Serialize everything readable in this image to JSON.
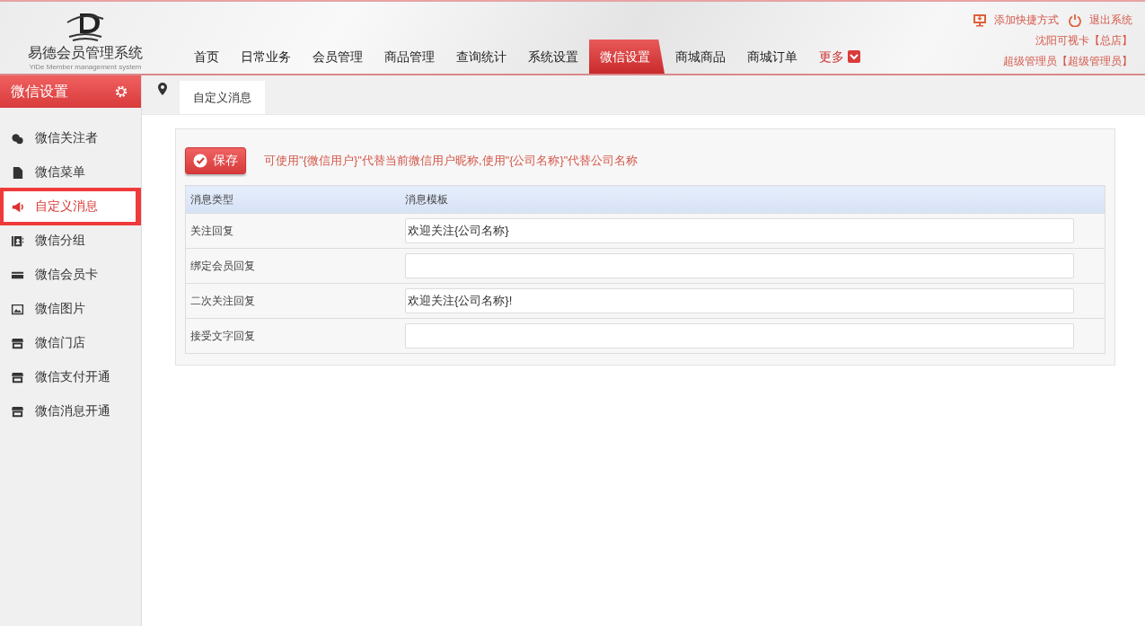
{
  "logo": {
    "title": "易德会员管理系统",
    "subtitle": "YiDe Member management system"
  },
  "nav": [
    {
      "label": "首页",
      "selected": false,
      "kind": "link"
    },
    {
      "label": "日常业务",
      "selected": false,
      "kind": "link"
    },
    {
      "label": "会员管理",
      "selected": false,
      "kind": "link"
    },
    {
      "label": "商品管理",
      "selected": false,
      "kind": "link"
    },
    {
      "label": "查询统计",
      "selected": false,
      "kind": "link"
    },
    {
      "label": "系统设置",
      "selected": false,
      "kind": "link"
    },
    {
      "label": "微信设置",
      "selected": true,
      "kind": "link"
    },
    {
      "label": "商城商品",
      "selected": false,
      "kind": "link"
    },
    {
      "label": "商城订单",
      "selected": false,
      "kind": "link"
    },
    {
      "label": "更多",
      "selected": false,
      "kind": "more"
    }
  ],
  "header_links": [
    {
      "label": "添加快捷方式",
      "kind": "shortcut"
    },
    {
      "label": "退出系统",
      "kind": "logout"
    }
  ],
  "store": "沈阳可视卡【总店】",
  "user": "超级管理员【超级管理员】",
  "sidebar": {
    "title": "微信设置",
    "items": [
      {
        "label": "微信关注者",
        "kind": "chat",
        "selected": false
      },
      {
        "label": "微信菜单",
        "kind": "file",
        "selected": false
      },
      {
        "label": "自定义消息",
        "kind": "megaphone",
        "selected": true
      },
      {
        "label": "微信分组",
        "kind": "contact",
        "selected": false
      },
      {
        "label": "微信会员卡",
        "kind": "card",
        "selected": false
      },
      {
        "label": "微信图片",
        "kind": "image",
        "selected": false
      },
      {
        "label": "微信门店",
        "kind": "store",
        "selected": false
      },
      {
        "label": "微信支付开通",
        "kind": "store",
        "selected": false
      },
      {
        "label": "微信消息开通",
        "kind": "store",
        "selected": false
      }
    ]
  },
  "tabs": [
    {
      "label": "自定义消息",
      "selected": true
    }
  ],
  "save_button": "保存",
  "hint": "可使用\"{微信用户}\"代替当前微信用户昵称,使用\"{公司名称}\"代替公司名称",
  "table": {
    "columns": [
      "消息类型",
      "消息模板"
    ],
    "rows": [
      {
        "type": "关注回复",
        "template": "欢迎关注{公司名称}"
      },
      {
        "type": "绑定会员回复"
      },
      {
        "type": "二次关注回复",
        "template": "欢迎关注{公司名称}!"
      },
      {
        "type": "接受文字回复"
      }
    ]
  }
}
